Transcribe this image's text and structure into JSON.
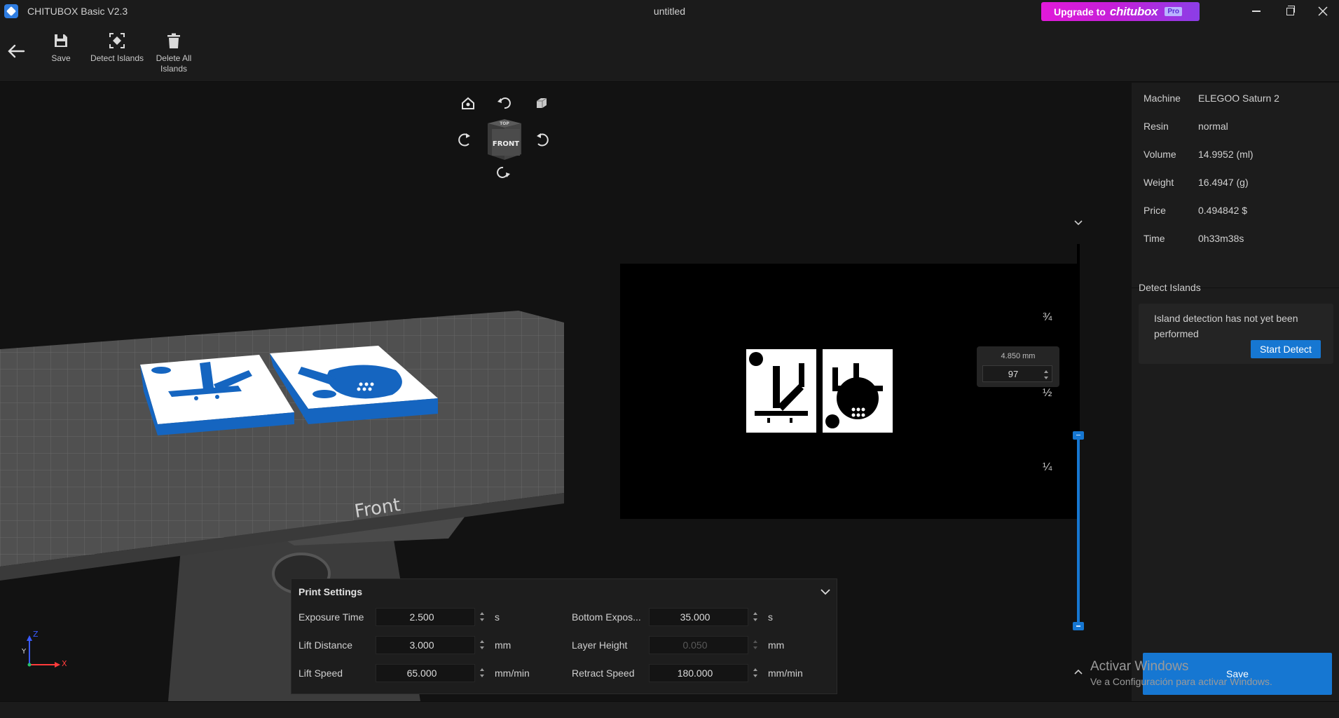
{
  "window": {
    "app_name": "CHITUBOX Basic V2.3",
    "document_title": "untitled",
    "upgrade_prefix": "Upgrade to",
    "upgrade_brand": "chitubox",
    "upgrade_badge": "Pro"
  },
  "toolbar": {
    "save_label": "Save",
    "detect_islands_label": "Detect Islands",
    "delete_all_line1": "Delete All",
    "delete_all_line2": "Islands"
  },
  "viewport": {
    "plate_label": "Front",
    "cube_front_label": "FRONT",
    "cube_top_label": "TOP",
    "axis_x": "X",
    "axis_y": "Y",
    "axis_z": "Z"
  },
  "slice_preview": {
    "fraction_top": "¾",
    "fraction_mid": "½",
    "fraction_bottom": "¼",
    "layer_height_mm": "4.850 mm",
    "layer_number": "97",
    "slider_position": 0.5
  },
  "info": {
    "rows": [
      {
        "key": "Machine",
        "value": "ELEGOO Saturn 2"
      },
      {
        "key": "Resin",
        "value": "normal"
      },
      {
        "key": "Volume",
        "value": "14.9952 (ml)"
      },
      {
        "key": "Weight",
        "value": "16.4947 (g)"
      },
      {
        "key": "Price",
        "value": "0.494842 $"
      },
      {
        "key": "Time",
        "value": "0h33m38s"
      }
    ],
    "detect_title": "Detect Islands",
    "detect_message": "Island detection has not yet been performed",
    "start_detect_label": "Start Detect",
    "save_label": "Save"
  },
  "print_settings": {
    "title": "Print Settings",
    "exposure_time": {
      "label": "Exposure Time",
      "value": "2.500",
      "unit": "s"
    },
    "bottom_exposure": {
      "label": "Bottom Expos...",
      "value": "35.000",
      "unit": "s"
    },
    "lift_distance": {
      "label": "Lift Distance",
      "value": "3.000",
      "unit": "mm"
    },
    "layer_height": {
      "label": "Layer Height",
      "value": "0.050",
      "unit": "mm"
    },
    "lift_speed": {
      "label": "Lift Speed",
      "value": "65.000",
      "unit": "mm/min"
    },
    "retract_speed": {
      "label": "Retract Speed",
      "value": "180.000",
      "unit": "mm/min"
    }
  },
  "watermark": {
    "line1": "Activar Windows",
    "line2": "Ve a Configuración para activar Windows."
  },
  "colors": {
    "accent": "#1677d2",
    "model_blue": "#1565c0",
    "upgrade_gradient_start": "#e11ad9",
    "upgrade_gradient_end": "#8b3ee6"
  }
}
